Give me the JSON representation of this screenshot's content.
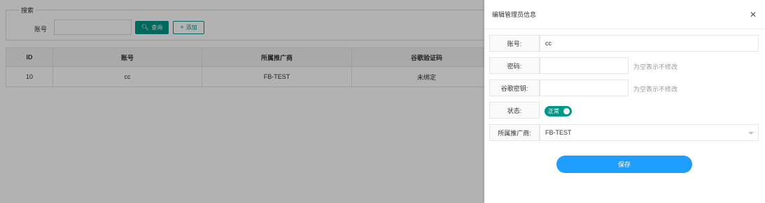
{
  "search": {
    "legend": "搜索",
    "account_label": "账号",
    "account_value": "",
    "query_button": "查询",
    "add_button": "添加"
  },
  "table": {
    "headers": [
      "ID",
      "账号",
      "所属推广商",
      "谷歌验证码",
      ""
    ],
    "rows": [
      [
        "10",
        "cc",
        "FB-TEST",
        "未绑定",
        ""
      ]
    ]
  },
  "drawer": {
    "title": "编辑管理员信息",
    "account_label": "账号:",
    "account_value": "cc",
    "password_label": "密码:",
    "password_value": "",
    "password_hint": "为空表示不修改",
    "google_key_label": "谷歌密钥:",
    "google_key_value": "",
    "google_key_hint": "为空表示不修改",
    "status_label": "状态:",
    "status_toggle_text": "正常",
    "status_on": true,
    "promoter_label": "所属推广商:",
    "promoter_value": "FB-TEST",
    "save_button": "保存"
  },
  "colors": {
    "primary_teal": "#009688",
    "save_blue": "#1e9fff"
  }
}
